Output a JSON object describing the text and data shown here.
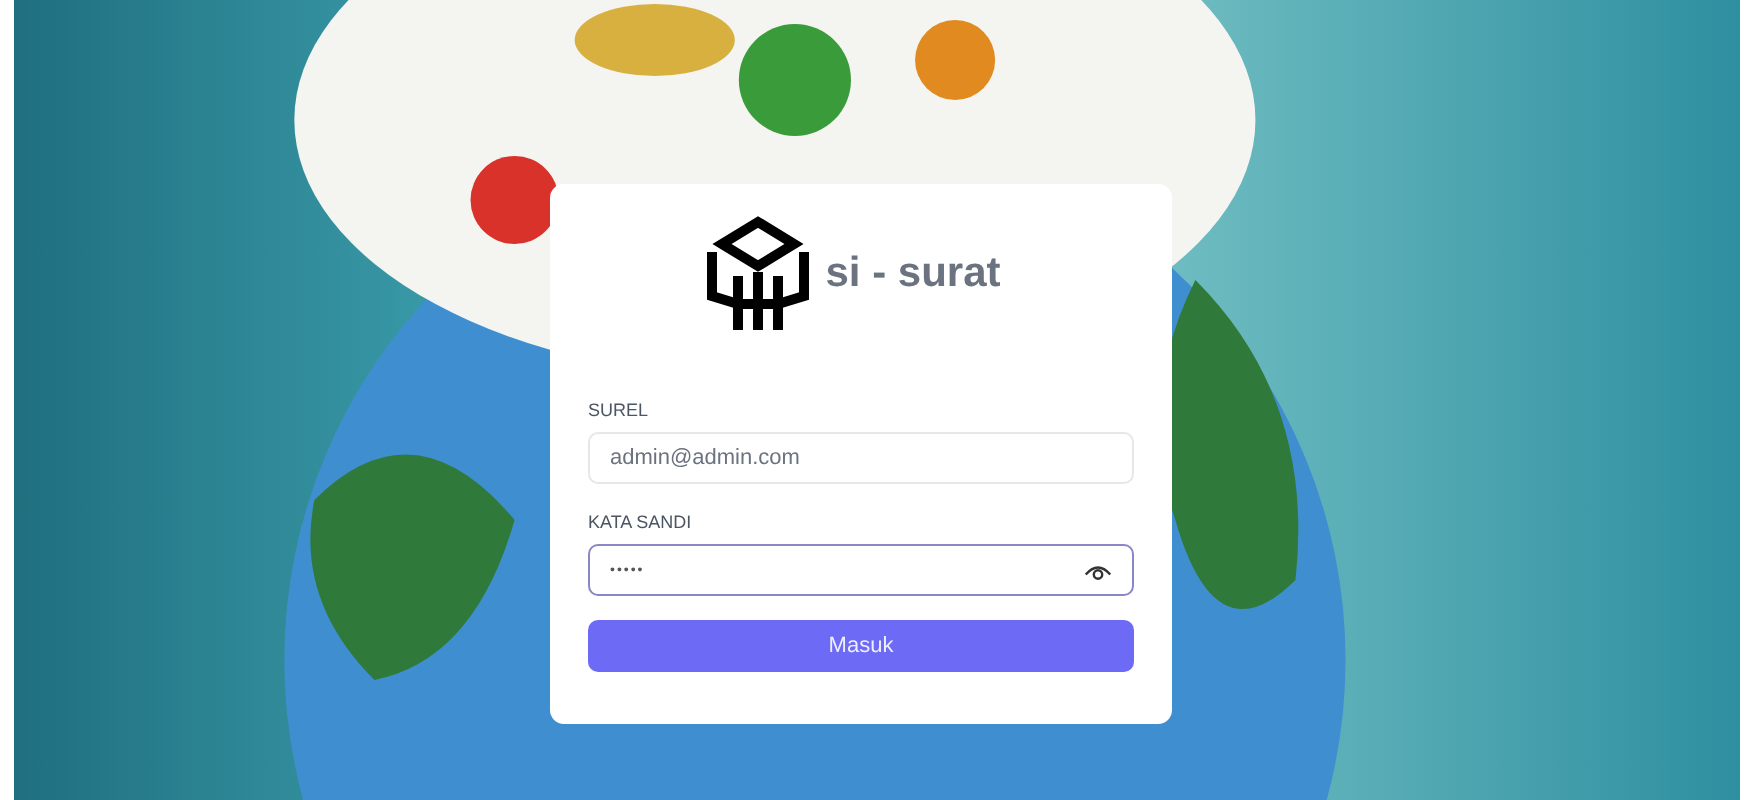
{
  "brand": {
    "name": "si - surat"
  },
  "form": {
    "fields": [
      {
        "kind": "text",
        "label": "SUREL",
        "value": "admin@admin.com",
        "focused": false
      },
      {
        "kind": "password",
        "label": "KATA SANDI",
        "value": "•••••",
        "focused": true
      }
    ],
    "submit": "Masuk"
  }
}
